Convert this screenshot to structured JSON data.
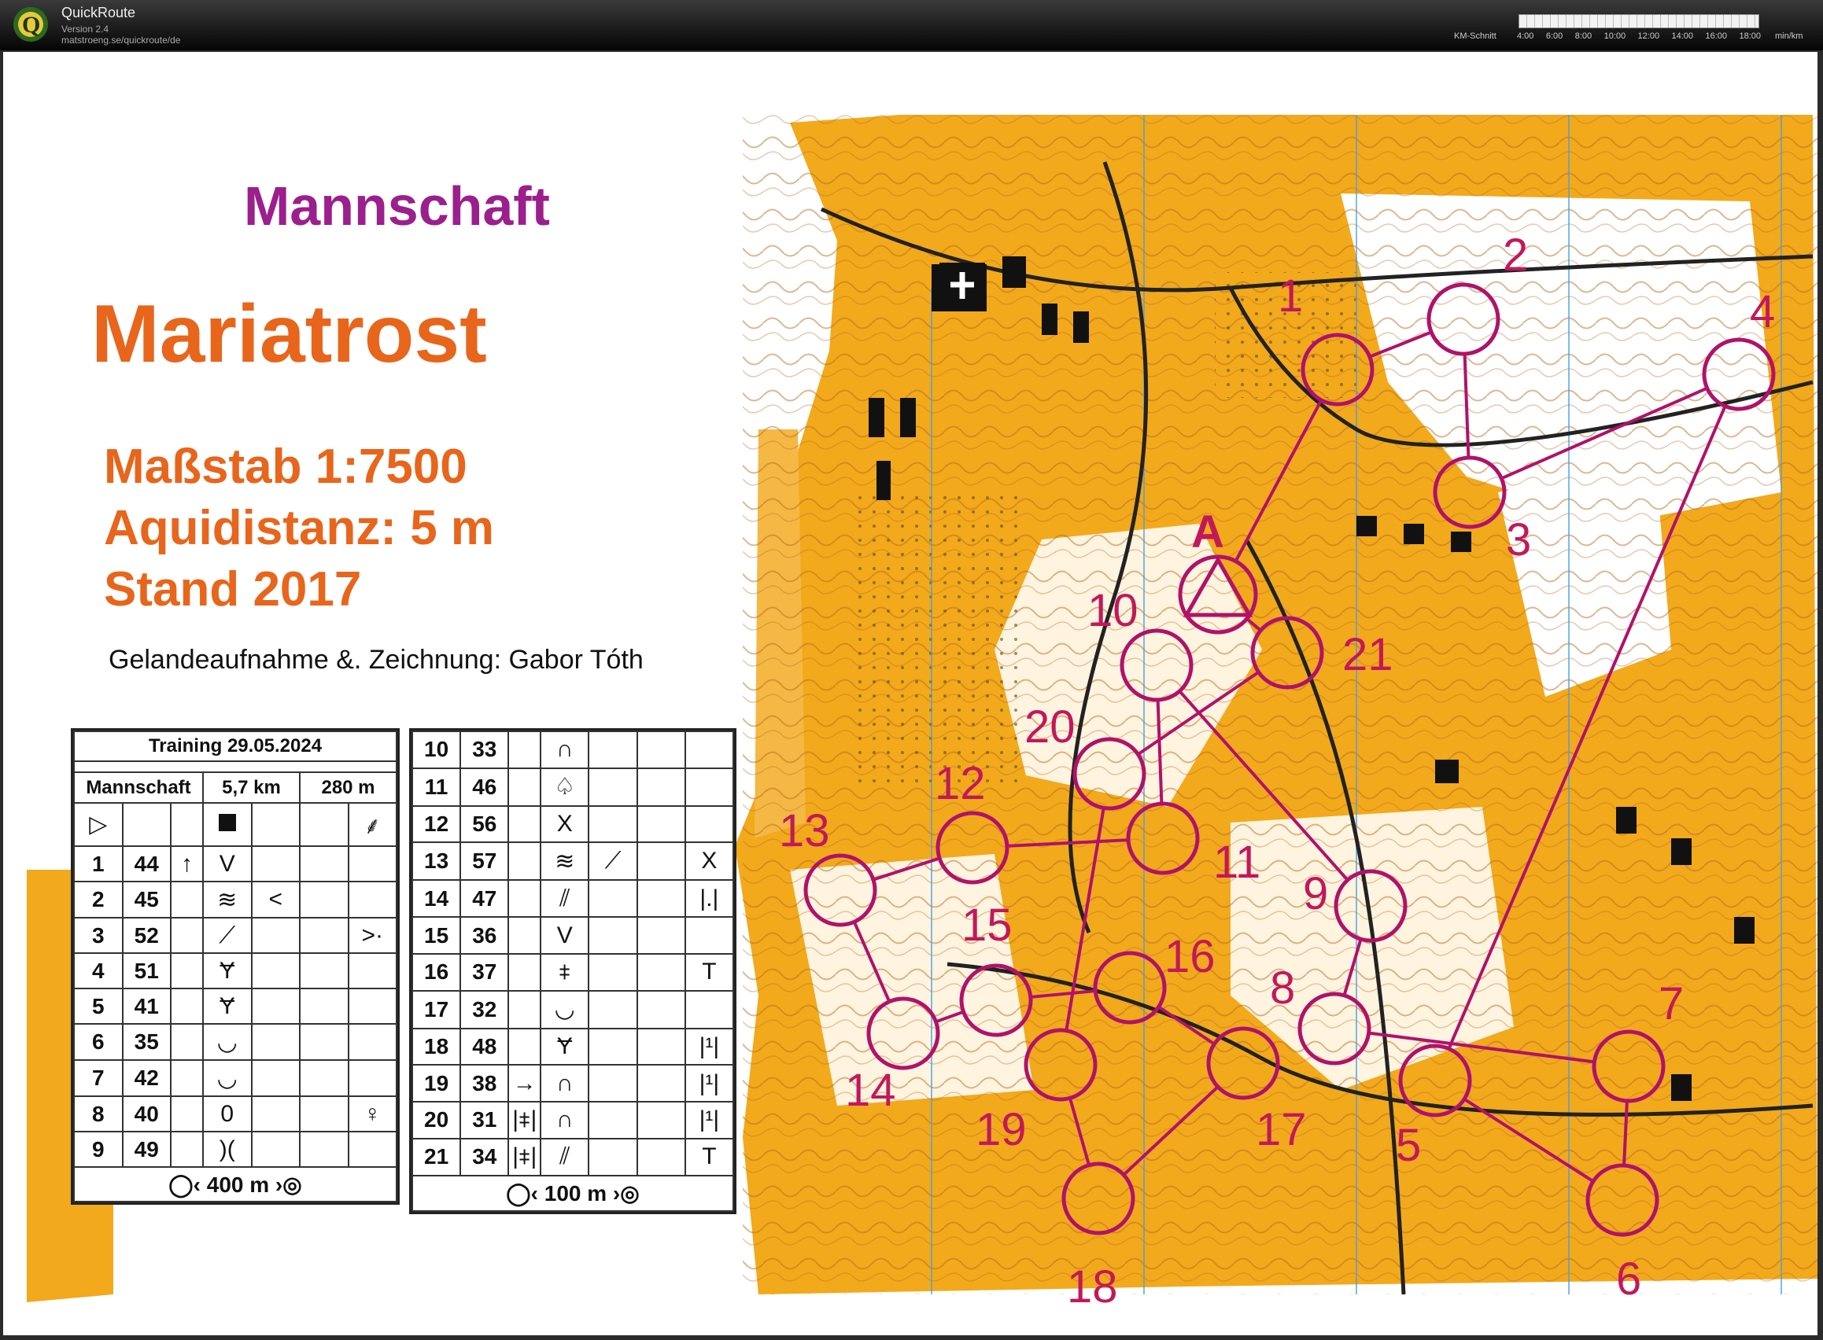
{
  "app": {
    "name": "QuickRoute",
    "version": "Version 2.4",
    "url": "matstroeng.se/quickroute/de",
    "legend_label": "KM-Schnitt",
    "legend_ticks": [
      "4:00",
      "6:00",
      "8:00",
      "10:00",
      "12:00",
      "14:00",
      "16:00",
      "18:00"
    ],
    "legend_unit": "min/km"
  },
  "map": {
    "team": "Mannschaft",
    "place": "Mariatrost",
    "scale": "Maßstab 1:7500",
    "equidistance": "Aquidistanz: 5 m",
    "year": "Stand 2017",
    "author": "Gelandeaufnahme &. Zeichnung: Gabor Tóth",
    "start_label": "A",
    "control_numbers": [
      "1",
      "2",
      "3",
      "4",
      "5",
      "6",
      "7",
      "8",
      "9",
      "10",
      "11",
      "12",
      "13",
      "14",
      "15",
      "16",
      "17",
      "18",
      "19",
      "20",
      "21"
    ],
    "colors": {
      "course": "#b0126a",
      "terrain": "#f2a91c",
      "open": "#ffffff"
    }
  },
  "description_left": {
    "event": "Training 29.05.2024",
    "class": "Mannschaft",
    "length": "5,7 km",
    "climb": "280 m",
    "start_symbol": "▷",
    "rows": [
      {
        "n": "1",
        "code": "44",
        "a": "↑",
        "b": "V",
        "c": "",
        "d": ""
      },
      {
        "n": "2",
        "code": "45",
        "a": "",
        "b": "≋",
        "c": "<",
        "d": ""
      },
      {
        "n": "3",
        "code": "52",
        "a": "",
        "b": "⟋",
        "c": "",
        "d": ">·"
      },
      {
        "n": "4",
        "code": "51",
        "a": "",
        "b": "Ɏ",
        "c": "",
        "d": ""
      },
      {
        "n": "5",
        "code": "41",
        "a": "",
        "b": "Ɏ",
        "c": "",
        "d": ""
      },
      {
        "n": "6",
        "code": "35",
        "a": "",
        "b": "◡",
        "c": "",
        "d": ""
      },
      {
        "n": "7",
        "code": "42",
        "a": "",
        "b": "◡",
        "c": "",
        "d": ""
      },
      {
        "n": "8",
        "code": "40",
        "a": "",
        "b": "0",
        "c": "",
        "d": "♀"
      },
      {
        "n": "9",
        "code": "49",
        "a": "",
        "b": ")(",
        "c": "",
        "d": ""
      }
    ],
    "footer": "400 m"
  },
  "description_right": {
    "rows": [
      {
        "n": "10",
        "code": "33",
        "a": "",
        "b": "∩",
        "c": "",
        "d": ""
      },
      {
        "n": "11",
        "code": "46",
        "a": "",
        "b": "♤",
        "c": "",
        "d": ""
      },
      {
        "n": "12",
        "code": "56",
        "a": "",
        "b": "X",
        "c": "",
        "d": ""
      },
      {
        "n": "13",
        "code": "57",
        "a": "",
        "b": "≋",
        "c": "⟋",
        "d": "X"
      },
      {
        "n": "14",
        "code": "47",
        "a": "",
        "b": "⫽",
        "c": "",
        "d": "|.|"
      },
      {
        "n": "15",
        "code": "36",
        "a": "",
        "b": "V",
        "c": "",
        "d": ""
      },
      {
        "n": "16",
        "code": "37",
        "a": "",
        "b": "⧧",
        "c": "",
        "d": "T"
      },
      {
        "n": "17",
        "code": "32",
        "a": "",
        "b": "◡",
        "c": "",
        "d": ""
      },
      {
        "n": "18",
        "code": "48",
        "a": "",
        "b": "Ɏ",
        "c": "",
        "d": "|¹|"
      },
      {
        "n": "19",
        "code": "38",
        "a": "→",
        "b": "∩",
        "c": "",
        "d": "|¹|"
      },
      {
        "n": "20",
        "code": "31",
        "a": "|⧧|",
        "b": "∩",
        "c": "",
        "d": "|¹|"
      },
      {
        "n": "21",
        "code": "34",
        "a": "|⧧|",
        "b": "⫽",
        "c": "",
        "d": "T"
      }
    ],
    "footer": "100 m"
  }
}
